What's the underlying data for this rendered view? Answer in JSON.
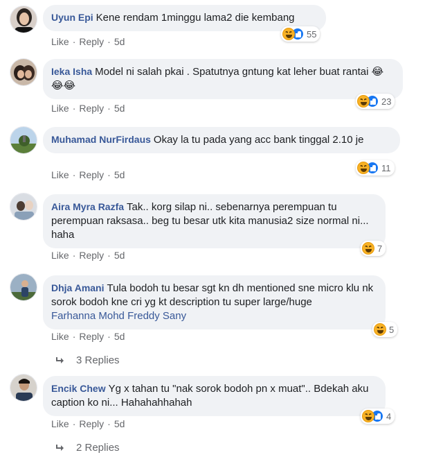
{
  "actions": {
    "like": "Like",
    "reply": "Reply",
    "sep": "·"
  },
  "comments": [
    {
      "author": "Uyun Epi",
      "text": "Kene rendam 1minggu lama2 die kembang",
      "reactions": "55",
      "time": "5d"
    },
    {
      "author": "Ieka Isha",
      "text": "Model ni salah pkai . Spatutnya gntung kat leher buat rantai 😂😂😂",
      "reactions": "23",
      "time": "5d"
    },
    {
      "author": "Muhamad NurFirdaus",
      "text": "Okay la tu pada yang acc bank tinggal 2.10 je",
      "reactions": "11",
      "time": "5d"
    },
    {
      "author": "Aira Myra Razfa",
      "text": "Tak.. korg silap ni.. sebenarnya perempuan tu perempuan raksasa.. beg tu besar utk kita manusia2 size normal ni... haha",
      "reactions": "7",
      "time": "5d"
    },
    {
      "author": "Dhja Amani",
      "text": "Tula bodoh tu besar sgt kn dh mentioned sne micro klu nk sorok bodoh kne cri yg kt description tu super large/huge",
      "tag": "Farhanna Mohd Freddy Sany",
      "reactions": "5",
      "time": "5d",
      "replies": "3 Replies"
    },
    {
      "author": "Encik Chew",
      "text": "Yg x tahan tu \"nak sorok bodoh pn x muat\".. Bdekah aku caption ko ni... Hahahahhahah",
      "reactions": "4",
      "time": "5d",
      "replies": "2 Replies"
    }
  ],
  "colors": {
    "author": "#385898",
    "bubble": "#f0f2f5",
    "meta": "#65676b",
    "like": "#1877f2",
    "haha": "#f7b125"
  },
  "icons": {
    "haha": "haha-reaction-icon",
    "like": "like-reaction-icon",
    "reply": "reply-arrow-icon"
  }
}
